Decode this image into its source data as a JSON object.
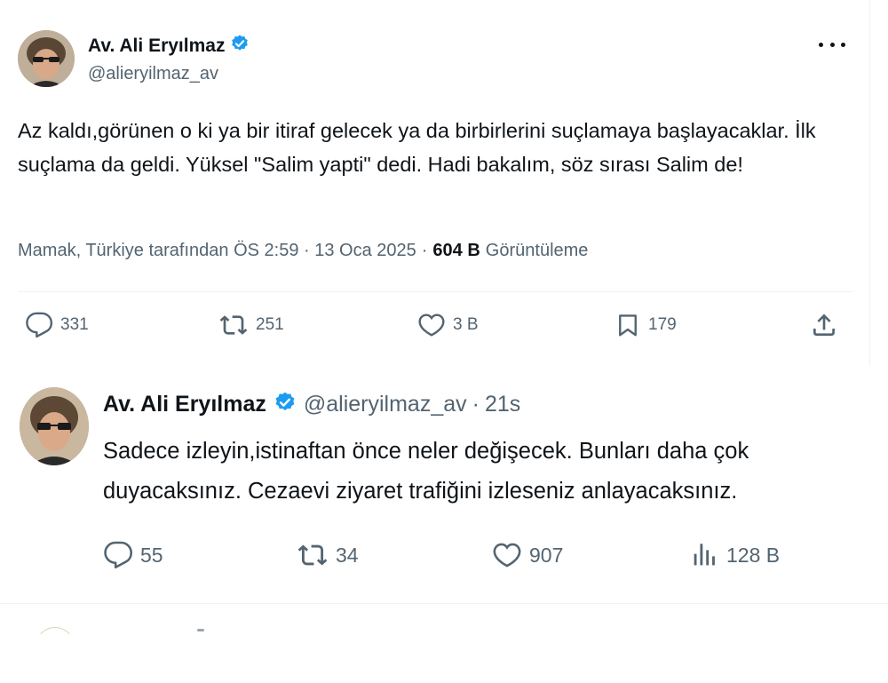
{
  "main_tweet": {
    "author_name": "Av. Ali Eryılmaz",
    "author_handle": "@alieryilmaz_av",
    "text": "Az kaldı,görünen o ki ya bir itiraf gelecek ya da birbirlerini suçlamaya başlayacaklar. İlk suçlama da geldi. Yüksel \"Salim yapti\" dedi. Hadi bakalım, söz sırası Salim de!",
    "location_time": "Mamak, Türkiye tarafından ÖS 2:59 · 13 Oca 2025",
    "views_count": "604 B",
    "views_label": "Görüntüleme",
    "replies": "331",
    "retweets": "251",
    "likes": "3 B",
    "bookmarks": "179"
  },
  "reply_tweet": {
    "author_name": "Av. Ali Eryılmaz",
    "author_handle": "@alieryilmaz_av",
    "dot": "·",
    "time": "21s",
    "text": "Sadece izleyin,istinaftan önce neler değişecek. Bunları daha çok duyacaksınız. Cezaevi ziyaret trafiğini izleseniz anlayacaksınız.",
    "replies": "55",
    "retweets": "34",
    "likes": "907",
    "views": "128 B"
  },
  "colors": {
    "text_primary": "#0f1419",
    "text_secondary": "#536471",
    "verified_blue": "#1d9bf0",
    "divider": "#eff3f4"
  },
  "icons": {
    "verified": "verified-badge-icon",
    "more": "more-horizontal-icon",
    "reply": "speech-bubble-icon",
    "retweet": "retweet-icon",
    "like": "heart-icon",
    "bookmark": "bookmark-icon",
    "share": "share-upload-icon",
    "views": "bar-chart-icon"
  }
}
